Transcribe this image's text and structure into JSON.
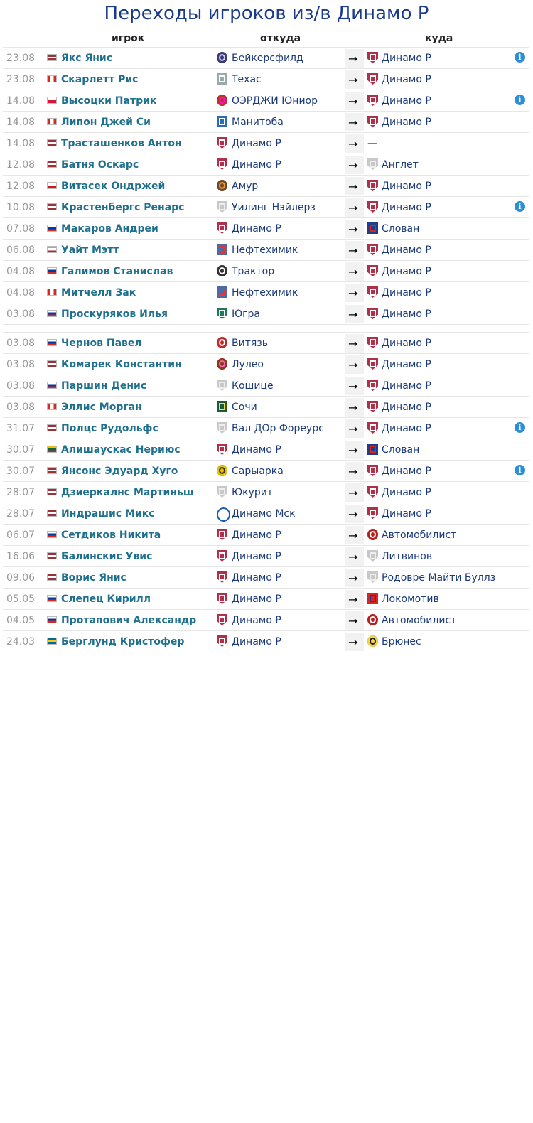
{
  "page": {
    "title": "Переходы игроков из/в Динамо Р"
  },
  "headers": {
    "player": "игрок",
    "from": "откуда",
    "to": "куда"
  },
  "colors": {
    "title": "#1a3a8a",
    "player_link": "#1f6f8e",
    "team_link": "#1a3a7a",
    "info_icon": "#2b8fd6"
  },
  "rows": [
    {
      "date": "23.08",
      "flag": "latvia",
      "player": "Якс Янис",
      "from": "Бейкерсфилд",
      "from_icon": "bakersfield-logo-icon",
      "to": "Динамо Р",
      "to_icon": "dinamo-riga-logo-icon",
      "info": true
    },
    {
      "date": "23.08",
      "flag": "canada",
      "player": "Скарлетт Рис",
      "from": "Техас",
      "from_icon": "texas-logo-icon",
      "to": "Динамо Р",
      "to_icon": "dinamo-riga-logo-icon",
      "info": false
    },
    {
      "date": "14.08",
      "flag": "poland",
      "player": "Высоцки Патрик",
      "from": "ОЭРДЖИ Юниор",
      "from_icon": "junior-logo-icon",
      "to": "Динамо Р",
      "to_icon": "dinamo-riga-logo-icon",
      "info": true
    },
    {
      "date": "14.08",
      "flag": "canada",
      "player": "Липон Джей Си",
      "from": "Манитоба",
      "from_icon": "manitoba-logo-icon",
      "to": "Динамо Р",
      "to_icon": "dinamo-riga-logo-icon",
      "info": false
    },
    {
      "date": "14.08",
      "flag": "latvia",
      "player": "Траcташенков Антон",
      "from": "Динамо Р",
      "from_icon": "dinamo-riga-logo-icon",
      "to": "—",
      "to_icon": "",
      "info": false
    },
    {
      "date": "12.08",
      "flag": "latvia",
      "player": "Батня Оскарс",
      "from": "Динамо Р",
      "from_icon": "dinamo-riga-logo-icon",
      "to": "Англет",
      "to_icon": "generic-shield-icon",
      "info": false
    },
    {
      "date": "12.08",
      "flag": "czech",
      "player": "Витасек Ондржей",
      "from": "Амур",
      "from_icon": "amur-logo-icon",
      "to": "Динамо Р",
      "to_icon": "dinamo-riga-logo-icon",
      "info": false
    },
    {
      "date": "10.08",
      "flag": "latvia",
      "player": "Крастенбергс Ренарс",
      "from": "Уилинг Нэйлерз",
      "from_icon": "generic-shield-icon",
      "to": "Динамо Р",
      "to_icon": "dinamo-riga-logo-icon",
      "info": true
    },
    {
      "date": "07.08",
      "flag": "russia",
      "player": "Макаров Андрей",
      "from": "Динамо Р",
      "from_icon": "dinamo-riga-logo-icon",
      "to": "Слован",
      "to_icon": "slovan-logo-icon",
      "info": false
    },
    {
      "date": "06.08",
      "flag": "usa",
      "player": "Уайт Мэтт",
      "from": "Нефтехимик",
      "from_icon": "neftekhimik-logo-icon",
      "to": "Динамо Р",
      "to_icon": "dinamo-riga-logo-icon",
      "info": false
    },
    {
      "date": "04.08",
      "flag": "russia",
      "player": "Галимов Станислав",
      "from": "Трактор",
      "from_icon": "traktor-logo-icon",
      "to": "Динамо Р",
      "to_icon": "dinamo-riga-logo-icon",
      "info": false
    },
    {
      "date": "04.08",
      "flag": "canada",
      "player": "Митчелл Зак",
      "from": "Нефтехимик",
      "from_icon": "neftekhimik-logo-icon",
      "to": "Динамо Р",
      "to_icon": "dinamo-riga-logo-icon",
      "info": false
    },
    {
      "date": "03.08",
      "flag": "russia",
      "player": "Проскуряков Илья",
      "from": "Югра",
      "from_icon": "yugra-logo-icon",
      "to": "Динамо Р",
      "to_icon": "dinamo-riga-logo-icon",
      "info": false
    },
    {
      "date": "03.08",
      "flag": "russia",
      "player": "Чернов Павел",
      "from": "Витязь",
      "from_icon": "vityaz-logo-icon",
      "to": "Динамо Р",
      "to_icon": "dinamo-riga-logo-icon",
      "info": false,
      "gap": true
    },
    {
      "date": "03.08",
      "flag": "latvia",
      "player": "Комарек Константин",
      "from": "Лулео",
      "from_icon": "lulea-logo-icon",
      "to": "Динамо Р",
      "to_icon": "dinamo-riga-logo-icon",
      "info": false
    },
    {
      "date": "03.08",
      "flag": "russia",
      "player": "Паршин Денис",
      "from": "Кошице",
      "from_icon": "generic-shield-icon",
      "to": "Динамо Р",
      "to_icon": "dinamo-riga-logo-icon",
      "info": false
    },
    {
      "date": "03.08",
      "flag": "canada",
      "player": "Эллис Морган",
      "from": "Сочи",
      "from_icon": "sochi-logo-icon",
      "to": "Динамо Р",
      "to_icon": "dinamo-riga-logo-icon",
      "info": false
    },
    {
      "date": "31.07",
      "flag": "latvia",
      "player": "Полцс Рудольфс",
      "from": "Вал ДОр Фореурс",
      "from_icon": "generic-shield-icon",
      "to": "Динамо Р",
      "to_icon": "dinamo-riga-logo-icon",
      "info": true
    },
    {
      "date": "30.07",
      "flag": "lithuania",
      "player": "Алишаускас Нериюс",
      "from": "Динамо Р",
      "from_icon": "dinamo-riga-logo-icon",
      "to": "Слован",
      "to_icon": "slovan-logo-icon",
      "info": false
    },
    {
      "date": "30.07",
      "flag": "latvia",
      "player": "Янсонс Эдуард Хуго",
      "from": "Сарыарка",
      "from_icon": "saryarka-logo-icon",
      "to": "Динамо Р",
      "to_icon": "dinamo-riga-logo-icon",
      "info": true
    },
    {
      "date": "28.07",
      "flag": "latvia",
      "player": "Дзиеркалнс Мартиньш",
      "from": "Юкурит",
      "from_icon": "generic-shield-icon",
      "to": "Динамо Р",
      "to_icon": "dinamo-riga-logo-icon",
      "info": false
    },
    {
      "date": "28.07",
      "flag": "latvia",
      "player": "Индрашис Микс",
      "from": "Динамо Мск",
      "from_icon": "dinamo-moscow-logo-icon",
      "to": "Динамо Р",
      "to_icon": "dinamo-riga-logo-icon",
      "info": false
    },
    {
      "date": "06.07",
      "flag": "russia",
      "player": "Сетдиков Никита",
      "from": "Динамо Р",
      "from_icon": "dinamo-riga-logo-icon",
      "to": "Автомобилист",
      "to_icon": "avtomobilist-logo-icon",
      "info": false
    },
    {
      "date": "16.06",
      "flag": "latvia",
      "player": "Балинскис Увис",
      "from": "Динамо Р",
      "from_icon": "dinamo-riga-logo-icon",
      "to": "Литвинов",
      "to_icon": "generic-shield-icon",
      "info": false
    },
    {
      "date": "09.06",
      "flag": "latvia",
      "player": "Ворис Янис",
      "from": "Динамо Р",
      "from_icon": "dinamo-riga-logo-icon",
      "to": "Родовре Майти Буллз",
      "to_icon": "generic-shield-icon",
      "info": false
    },
    {
      "date": "05.05",
      "flag": "russia",
      "player": "Слепец Кирилл",
      "from": "Динамо Р",
      "from_icon": "dinamo-riga-logo-icon",
      "to": "Локомотив",
      "to_icon": "lokomotiv-logo-icon",
      "info": false
    },
    {
      "date": "04.05",
      "flag": "russia",
      "player": "Протапович Александр",
      "from": "Динамо Р",
      "from_icon": "dinamo-riga-logo-icon",
      "to": "Автомобилист",
      "to_icon": "avtomobilist-logo-icon",
      "info": false
    },
    {
      "date": "24.03",
      "flag": "sweden",
      "player": "Берглунд Кристофер",
      "from": "Динамо Р",
      "from_icon": "dinamo-riga-logo-icon",
      "to": "Брюнес",
      "to_icon": "brynas-logo-icon",
      "info": false
    }
  ]
}
